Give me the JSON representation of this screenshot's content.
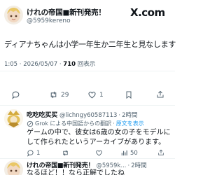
{
  "site": {
    "brand": "X.com"
  },
  "main_post": {
    "display_name": "けれの帝国■新刊発売！",
    "handle": "@5959kereno",
    "text": "ディアナちゃんは小学一年生か二年生と見なします",
    "time": "1:05 · 2026/05/07 ·",
    "views_count": "710",
    "views_label": "回表示",
    "actions": {
      "replies": "",
      "reposts": "29",
      "likes": "1",
      "bookmarks": "",
      "share": ""
    }
  },
  "reply_1": {
    "display_name": "吃吃吃买买",
    "handle": "@lichngy60587113",
    "time": "2時間",
    "translation_note": "Grok による中国語からの翻訳",
    "translation_link": "原文を表示",
    "text": "ゲームの中で、彼女は6歳の女の子をモデルにして作られたというアーカイブがあります。",
    "actions": {
      "replies": "1",
      "reposts": "",
      "likes": "",
      "views": "50"
    }
  },
  "reply_2": {
    "display_name": "けれの帝国■新刊発売！",
    "handle": "@5959k...",
    "time": "2時間",
    "text": "なるほど！！なら正解でしたね",
    "actions": {
      "replies": "",
      "reposts": "",
      "likes": "",
      "views": "51"
    }
  }
}
